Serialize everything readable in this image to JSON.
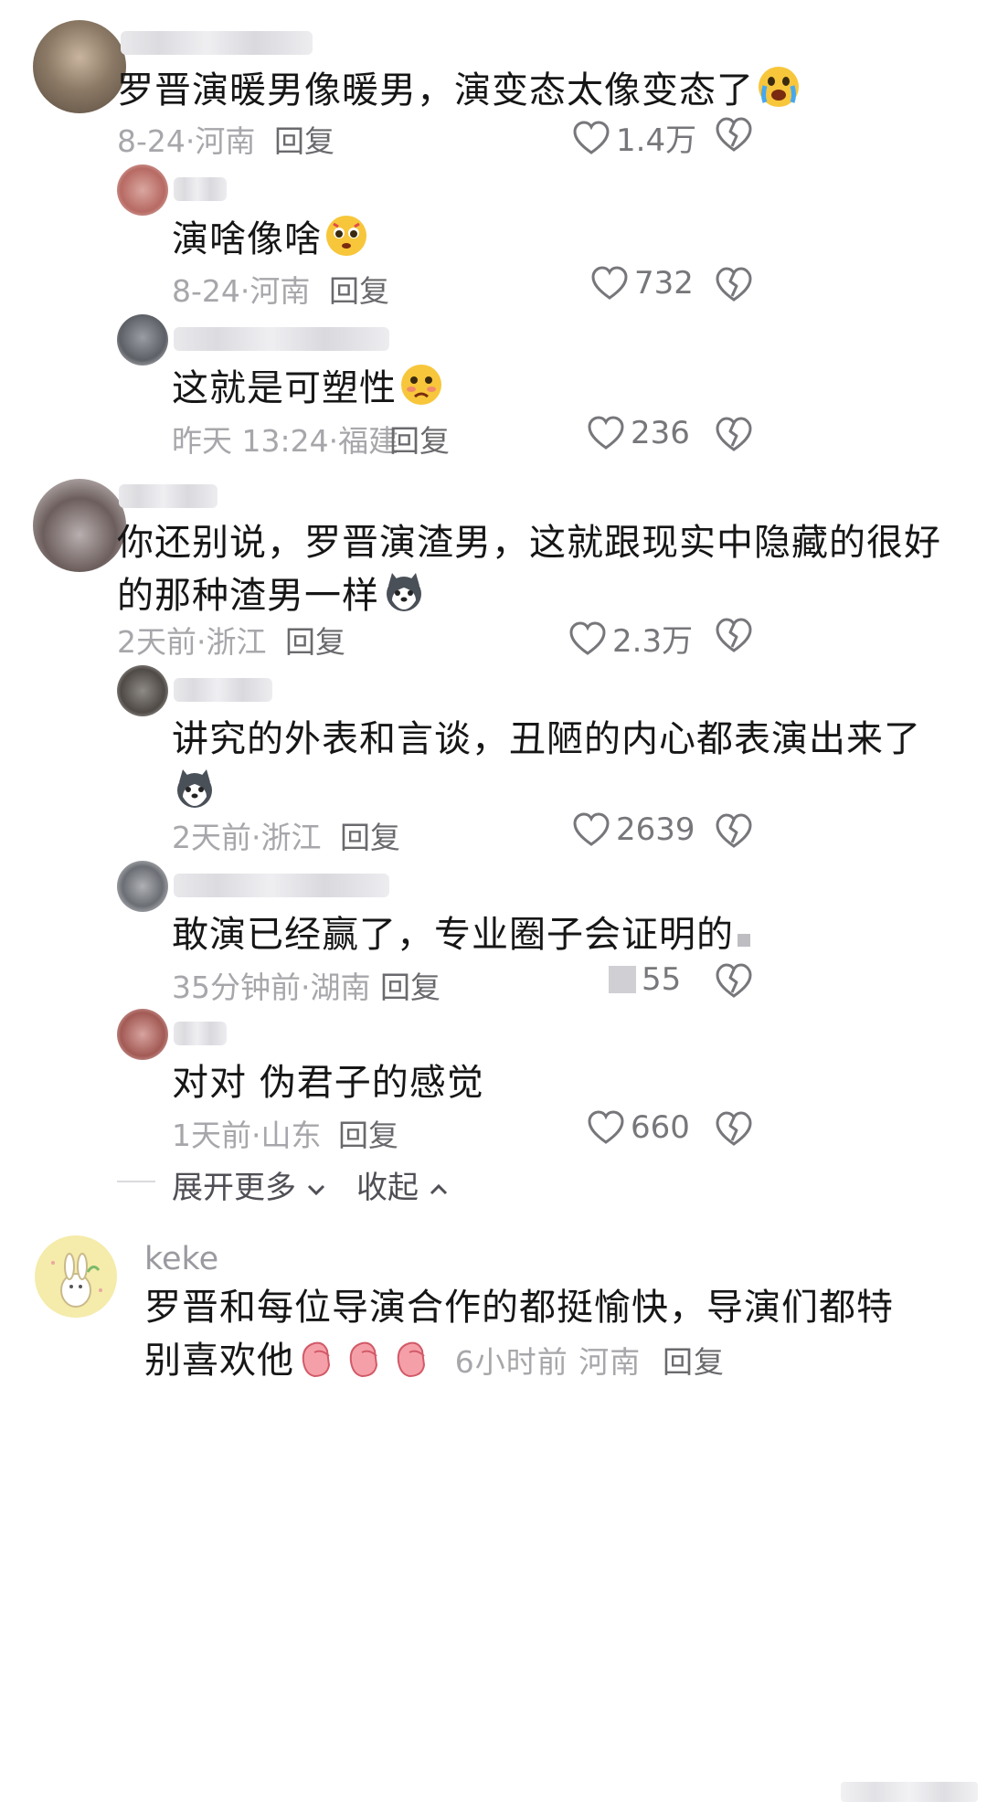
{
  "comments": [
    {
      "text": "罗晋演暖男像暖男，演变态太像变态了",
      "emoji": "crying-face-emoji",
      "time": "8-24",
      "location": "河南",
      "reply_label": "回复",
      "likes": "1.4万",
      "replies": [
        {
          "text": "演啥像啥",
          "emoji": "pleading-face-emoji",
          "time": "8-24",
          "location": "河南",
          "reply_label": "回复",
          "likes": "732"
        },
        {
          "text": "这就是可塑性",
          "emoji": "shy-face-emoji",
          "time": "昨天 13:24",
          "location": "福建",
          "reply_label": "回复",
          "likes": "236"
        }
      ]
    },
    {
      "text_line1": "你还别说，罗晋演渣男，这就跟现实中隐藏的很好",
      "text_line2": "的那种渣男一样",
      "emoji": "husky-dog-emoji",
      "time": "2天前",
      "location": "浙江",
      "reply_label": "回复",
      "likes": "2.3万",
      "replies": [
        {
          "text": "讲究的外表和言谈，丑陋的内心都表演出来了",
          "emoji": "husky-dog-emoji",
          "time": "2天前",
          "location": "浙江",
          "reply_label": "回复",
          "likes": "2639"
        },
        {
          "text": "敢演已经赢了，专业圈子会证明的",
          "time": "35分钟前",
          "location": "湖南",
          "reply_label": "回复",
          "likes": "55"
        },
        {
          "text": "对对 伪君子的感觉",
          "time": "1天前",
          "location": "山东",
          "reply_label": "回复",
          "likes": "660"
        }
      ]
    }
  ],
  "thread_actions": {
    "expand_label": "展开更多",
    "collapse_label": "收起"
  },
  "last_comment": {
    "username": "keke",
    "text_line1": "罗晋和每位导演合作的都挺愉快，导演们都特",
    "text_line2": "别喜欢他",
    "emoji": "clapping-hands-emoji",
    "time": "6小时前",
    "location": "河南",
    "reply_label": "回复"
  },
  "meta_separator": "·"
}
